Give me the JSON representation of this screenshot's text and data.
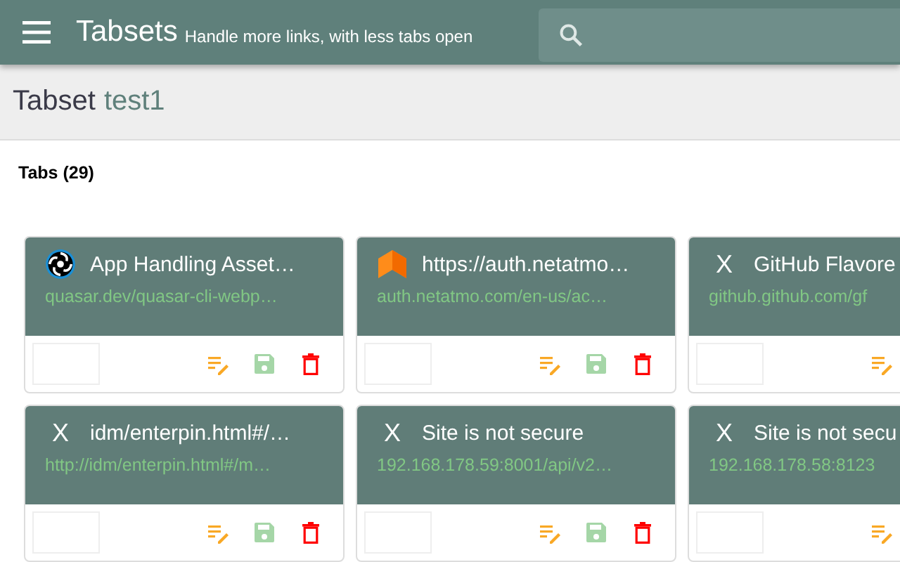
{
  "header": {
    "title": "Tabsets",
    "subtitle": "Handle more links, with less tabs open"
  },
  "tabset": {
    "label": "Tabset",
    "name": "test1"
  },
  "section": {
    "title": "Tabs (29)"
  },
  "cards": [
    {
      "kind": "swirl",
      "title": "App Handling Asset…",
      "url": "quasar.dev/quasar-cli-webp…"
    },
    {
      "kind": "chevron",
      "title": "https://auth.netatmo…",
      "url": "auth.netatmo.com/en-us/ac…"
    },
    {
      "kind": "letter",
      "icon_text": "X",
      "title": "GitHub Flavore",
      "url": "github.github.com/gf"
    },
    {
      "kind": "letter",
      "icon_text": "X",
      "title": "idm/enterpin.html#/…",
      "url": "http://idm/enterpin.html#/m…"
    },
    {
      "kind": "letter",
      "icon_text": "X",
      "title": "Site is not secure",
      "url": "192.168.178.59:8001/api/v2…"
    },
    {
      "kind": "letter",
      "icon_text": "X",
      "title": "Site is not secu",
      "url": "192.168.178.58:8123"
    }
  ]
}
